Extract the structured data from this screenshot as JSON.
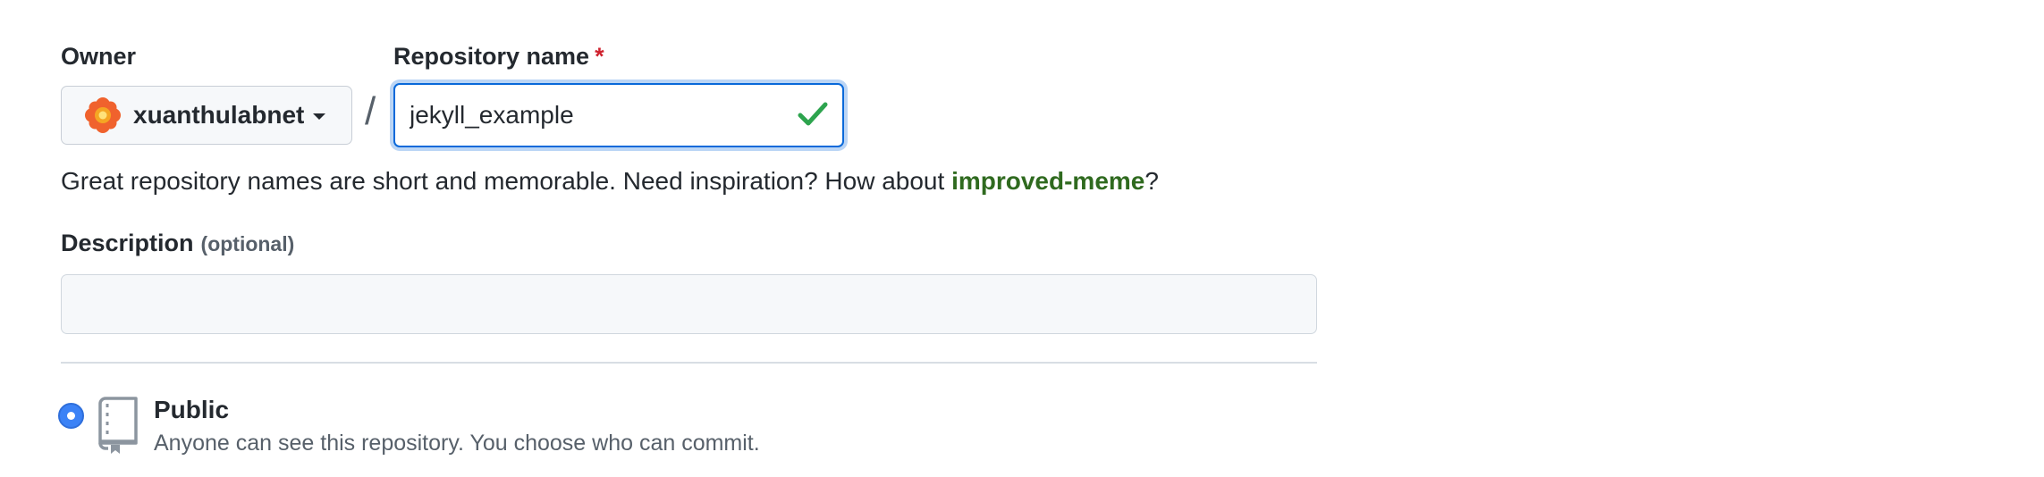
{
  "owner": {
    "label": "Owner",
    "selected": "xuanthulabnet",
    "avatar_icon": "orange-flower-avatar"
  },
  "separator": "/",
  "repository": {
    "label": "Repository name",
    "required_mark": "*",
    "value": "jekyll_example",
    "valid": true
  },
  "help": {
    "text_before": "Great repository names are short and memorable. Need inspiration? How about ",
    "suggestion": "improved-meme",
    "text_after": "?"
  },
  "description": {
    "label": "Description",
    "optional_label": "(optional)",
    "value": ""
  },
  "visibility": {
    "selected": "public",
    "public": {
      "title": "Public",
      "description": "Anyone can see this repository. You choose who can commit."
    }
  },
  "colors": {
    "accent": "#0969da",
    "success": "#2da44e",
    "suggestion": "#2f6a1f",
    "required": "#cf222e"
  }
}
